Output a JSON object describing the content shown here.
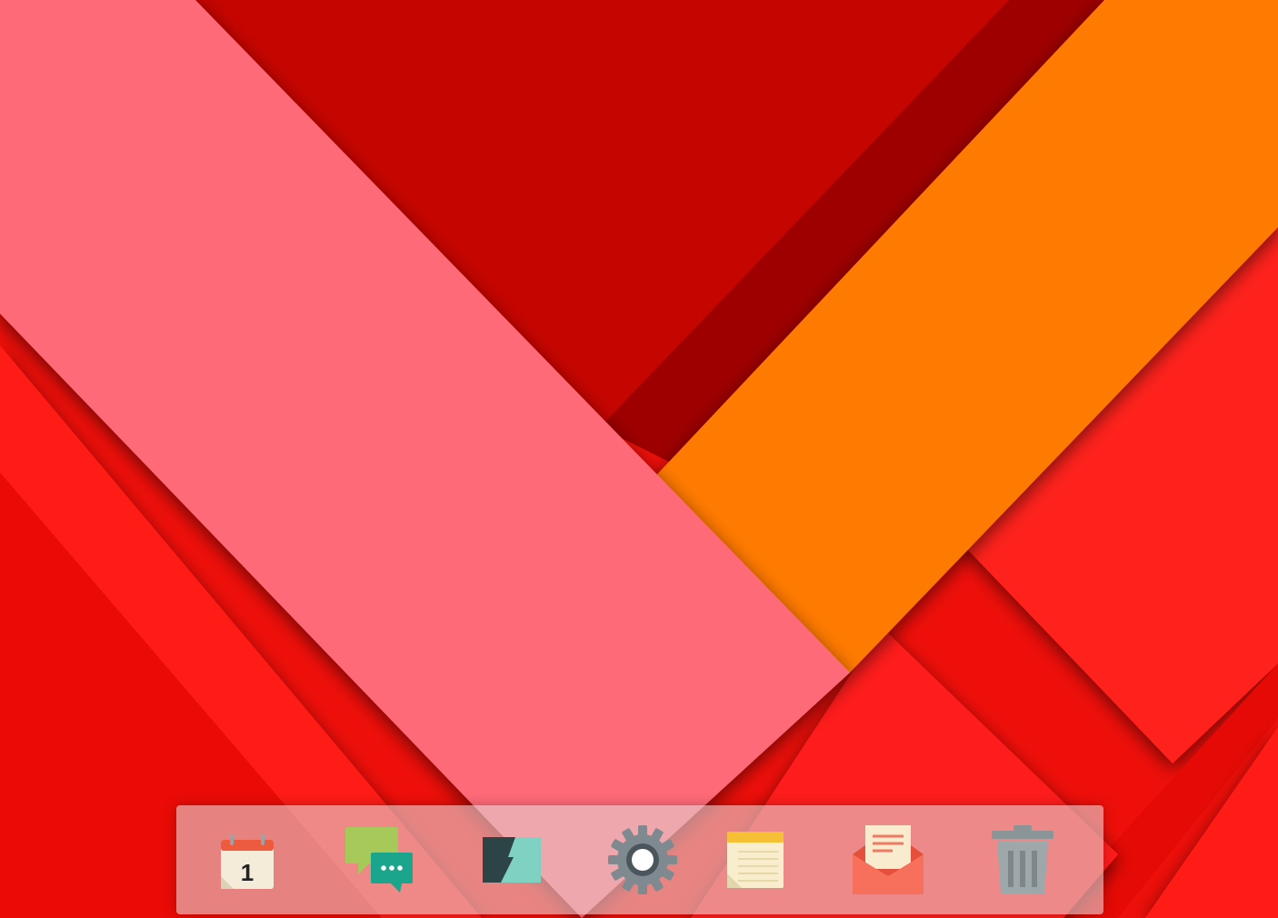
{
  "wallpaper": {
    "name": "material-design-wallpaper",
    "colors": {
      "base": "#ee0f0a",
      "dark_red": "#c50500",
      "shadow_red": "#9e0000",
      "bright_red": "#ff1e1a",
      "pink": "#ff6b78",
      "orange": "#ff7a00"
    }
  },
  "dock": {
    "items": [
      {
        "name": "calendar",
        "icon": "calendar-icon",
        "icon_text": "1"
      },
      {
        "name": "messages",
        "icon": "chat-bubbles-icon"
      },
      {
        "name": "terminal",
        "icon": "lightning-app-icon"
      },
      {
        "name": "settings",
        "icon": "gear-icon"
      },
      {
        "name": "notes",
        "icon": "notepad-icon"
      },
      {
        "name": "mail",
        "icon": "envelope-icon"
      },
      {
        "name": "trash",
        "icon": "trash-icon"
      }
    ]
  }
}
